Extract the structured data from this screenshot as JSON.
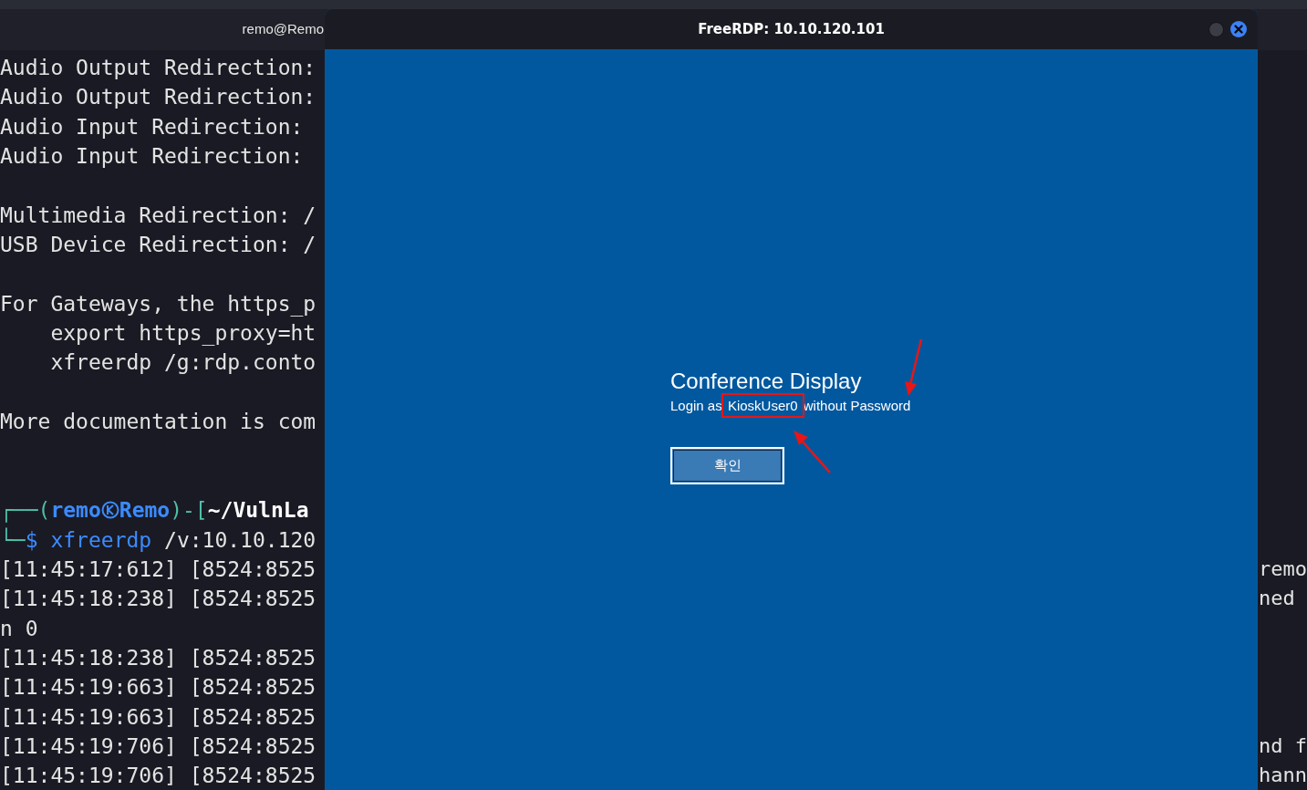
{
  "terminal": {
    "title": "remo@Remo",
    "lines": [
      {
        "kind": "text",
        "text": "Audio Output Redirection:"
      },
      {
        "kind": "text",
        "text": "Audio Output Redirection:"
      },
      {
        "kind": "text",
        "text": "Audio Input Redirection:"
      },
      {
        "kind": "text",
        "text": "Audio Input Redirection:"
      },
      {
        "kind": "blank"
      },
      {
        "kind": "text",
        "text": "Multimedia Redirection: /"
      },
      {
        "kind": "text",
        "text": "USB Device Redirection: /"
      },
      {
        "kind": "blank"
      },
      {
        "kind": "text",
        "text": "For Gateways, the https_p"
      },
      {
        "kind": "text",
        "text": "    export https_proxy=ht"
      },
      {
        "kind": "text",
        "text": "    xfreerdp /g:rdp.conto"
      },
      {
        "kind": "blank"
      },
      {
        "kind": "text",
        "text": "More documentation is com"
      },
      {
        "kind": "blank"
      },
      {
        "kind": "blank"
      },
      {
        "kind": "prompt",
        "corner": "┌──(",
        "user": "remo",
        "host": "Remo",
        "close": ")-[",
        "path": "~/VulnLa"
      },
      {
        "kind": "command",
        "corner": "└─",
        "sigil": "$",
        "program": "xfreerdp",
        "args": " /v:10.10.120"
      },
      {
        "kind": "text",
        "text": "[11:45:17:612] [8524:8525",
        "right": "remo"
      },
      {
        "kind": "text",
        "text": "[11:45:18:238] [8524:8525",
        "right": "ned"
      },
      {
        "kind": "text",
        "text": "n 0"
      },
      {
        "kind": "text",
        "text": "[11:45:18:238] [8524:8525"
      },
      {
        "kind": "text",
        "text": "[11:45:19:663] [8524:8525"
      },
      {
        "kind": "text",
        "text": "[11:45:19:663] [8524:8525"
      },
      {
        "kind": "text",
        "text": "[11:45:19:706] [8524:8525",
        "right": "nd f"
      },
      {
        "kind": "text",
        "text": "[11:45:19:706] [8524:8525",
        "right": "hann"
      }
    ]
  },
  "rdp_window": {
    "title": "FreeRDP: 10.10.120.101",
    "heading": "Conference Display",
    "login": {
      "prefix": "Login as ",
      "user": "KioskUser0",
      "suffix": " without Password"
    },
    "button": "확인"
  }
}
